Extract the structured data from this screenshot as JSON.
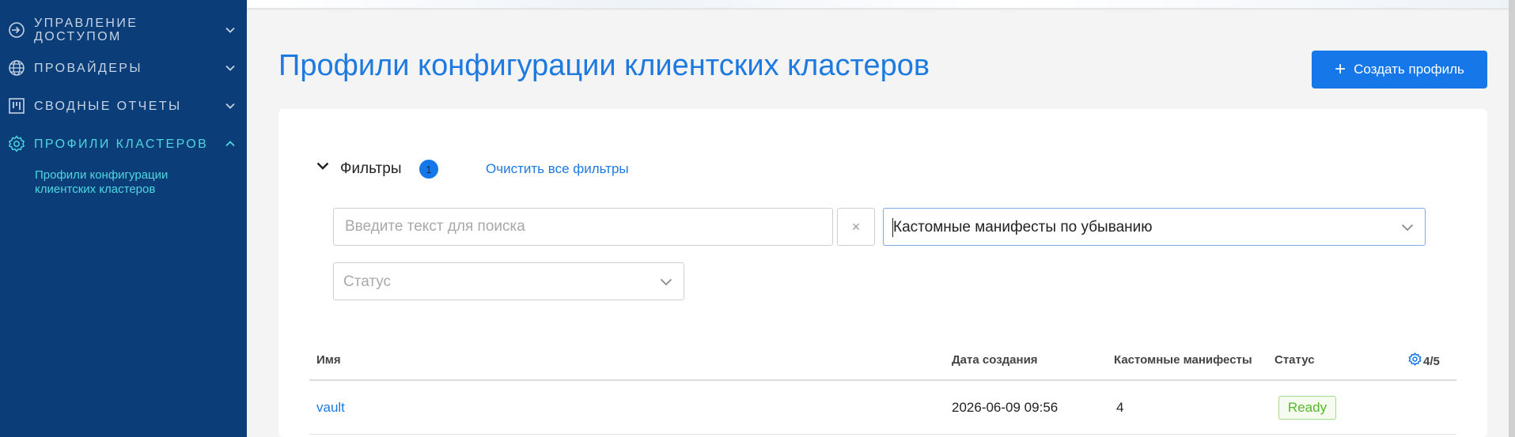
{
  "sidebar": {
    "items": [
      {
        "label": "Управление доступом",
        "icon": "sign-in-icon",
        "expanded": false
      },
      {
        "label": "Провайдеры",
        "icon": "globe-icon",
        "expanded": false
      },
      {
        "label": "Сводные отчеты",
        "icon": "board-icon",
        "expanded": false
      },
      {
        "label": "Профили кластеров",
        "icon": "gear-icon",
        "expanded": true
      }
    ],
    "subitems": [
      {
        "label": "Профили конфигурации клиентских кластеров"
      }
    ]
  },
  "header": {
    "title": "Профили конфигурации клиентских кластеров",
    "create_button_label": "Создать профиль"
  },
  "filters": {
    "title": "Фильтры",
    "count": "1",
    "clear_all_label": "Очистить все фильтры",
    "search_placeholder": "Введите текст для поиска",
    "search_value": "",
    "clear_symbol": "×",
    "sort_value": "Кастомные манифесты по убыванию",
    "status_placeholder": "Статус"
  },
  "table": {
    "columns": [
      "Имя",
      "Дата создания",
      "Кастомные манифесты",
      "Статус"
    ],
    "visible_columns": "4/5",
    "rows": [
      {
        "name": "vault",
        "created": "2026-06-09 09:56",
        "manifests": "4",
        "status": "Ready"
      }
    ]
  },
  "colors": {
    "sidebar_bg": "#0b3e78",
    "accent": "#1677e8",
    "active_nav": "#4fd6e0",
    "status_ready": "#58b62e"
  }
}
